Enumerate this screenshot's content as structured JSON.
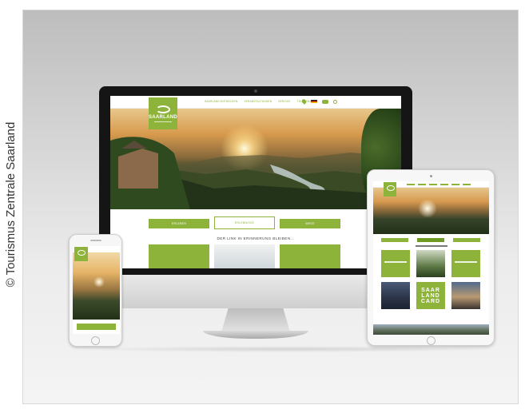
{
  "credit": "© Tourismus Zentrale Saarland",
  "desktop_site": {
    "logo_text": "SAARLAND",
    "nav_links": [
      "SAARLAND ENTDECKEN",
      "VERANSTALTUNGEN",
      "SERVICE",
      "TOURISMUS"
    ],
    "tabs": [
      {
        "label": "ERLEBEN",
        "active": false
      },
      {
        "label": "ERLEBNISSE",
        "active": true
      },
      {
        "label": "WEGE",
        "active": false
      }
    ],
    "heading": "DER LINK IN ERINNERUNG BLEIBEN..."
  },
  "tablet_site": {
    "card_text": "SAAR\nLAND\nCARD"
  },
  "colors": {
    "brand_green": "#8db33a"
  }
}
